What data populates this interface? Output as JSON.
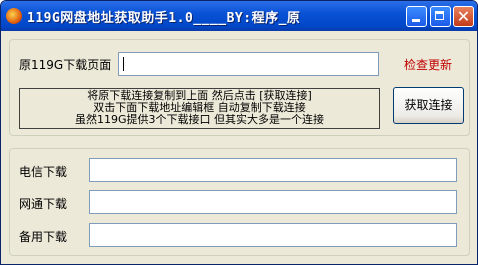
{
  "window": {
    "title": "119G网盘地址获取助手1.0____BY:程序_原"
  },
  "top_panel": {
    "source_label": "原119G下载页面",
    "source_value": "",
    "check_update_link": "检查更新",
    "hint_lines": [
      "将原下载连接复制到上面 然后点击 [获取连接]",
      "双击下面下载地址编辑框 自动复制下载连接",
      "虽然119G提供3个下载接口 但其实大多是一个连接"
    ],
    "get_link_button": "获取连接"
  },
  "bottom_panel": {
    "telecom_label": "电信下载",
    "telecom_value": "",
    "netcom_label": "网通下载",
    "netcom_value": "",
    "backup_label": "备用下载",
    "backup_value": ""
  },
  "colors": {
    "titlebar": "#0a53d6",
    "window_bg": "#ece9d8",
    "link": "#c00000"
  }
}
